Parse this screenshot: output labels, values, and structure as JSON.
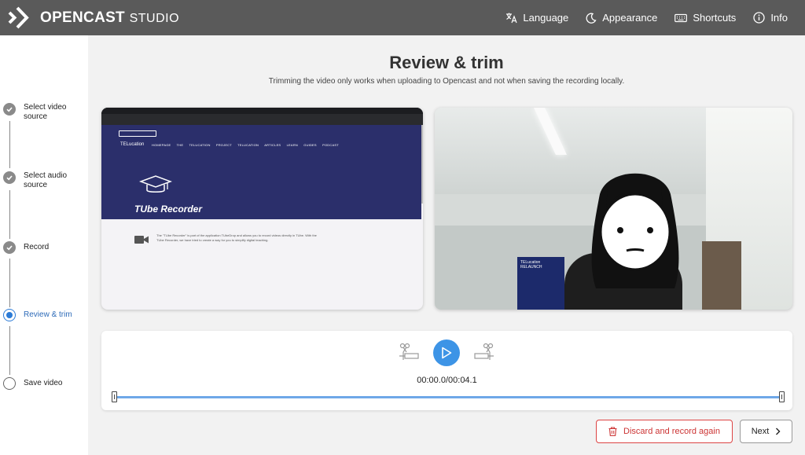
{
  "header": {
    "brand": "OPENCAST",
    "brand_suffix": "STUDIO",
    "nav": [
      {
        "label": "Language",
        "icon": "language-icon"
      },
      {
        "label": "Appearance",
        "icon": "moon-icon"
      },
      {
        "label": "Shortcuts",
        "icon": "keyboard-icon"
      },
      {
        "label": "Info",
        "icon": "info-icon"
      }
    ]
  },
  "steps": [
    {
      "label": "Select video source",
      "state": "done"
    },
    {
      "label": "Select audio source",
      "state": "done"
    },
    {
      "label": "Record",
      "state": "done"
    },
    {
      "label": "Review & trim",
      "state": "current"
    },
    {
      "label": "Save video",
      "state": "todo"
    }
  ],
  "main": {
    "title": "Review & trim",
    "subtitle": "Trimming the video only works when uploading to Opencast and not when saving the recording locally."
  },
  "screen_preview": {
    "site_brand": "TELucation",
    "site_menu": "HOMEPAGE THE TELUCATION PROJECT TELUCATION ARTICLES LEARN GUIDES PODCAST",
    "site_title": "TUbe Recorder",
    "body_text": "The \"TUbe Recorder\" is part of the application TUbeDrop and allows you to record videos directly in TUbe. With the TUbe Recorder, we have tried to create a way for you to simplify digital teaching."
  },
  "webcam_preview": {
    "poster_text": "TELucation RELAUNCH"
  },
  "player": {
    "timecode": "00:00.0/00:04.1",
    "progress": 0
  },
  "actions": {
    "discard_label": "Discard and record again",
    "next_label": "Next"
  },
  "colors": {
    "accent": "#3d94e6",
    "header_bg": "#5a5a5a",
    "danger": "#dd4444"
  }
}
